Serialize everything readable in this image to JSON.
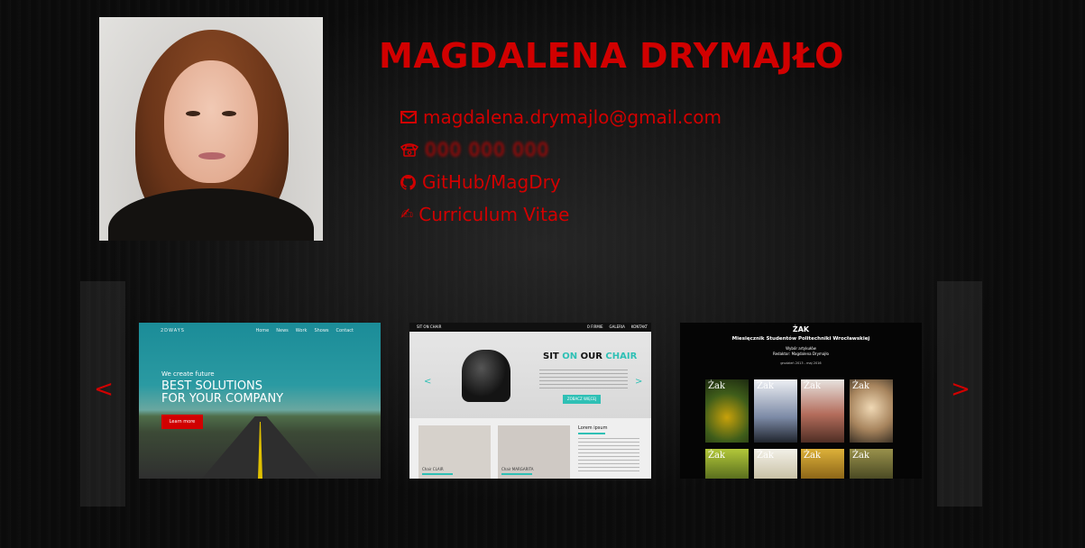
{
  "profile": {
    "name": "MAGDALENA DRYMAJŁO",
    "photo_icon": "profile-photo"
  },
  "contacts": {
    "email": {
      "icon": "envelope-icon",
      "text": "magdalena.drymajlo@gmail.com"
    },
    "phone": {
      "icon": "telephone-icon",
      "text": "000 000 000"
    },
    "github": {
      "icon": "github-icon",
      "text": "GitHub/MagDry"
    },
    "cv": {
      "icon": "writing-hand-icon",
      "text": "Curriculum Vitae"
    }
  },
  "carousel": {
    "prev_label": "<",
    "next_label": ">",
    "slides": [
      {
        "brand": "2DWAYS",
        "nav_links": [
          "Home",
          "News",
          "Work",
          "Shows",
          "Contact"
        ],
        "tagline": "We create future",
        "headline": "BEST SOLUTIONS\nFOR YOUR COMPANY",
        "cta": "Learn more"
      },
      {
        "brand": "SIT ON CHAIR",
        "nav_links": [
          "O FIRMIE",
          "GALERIA",
          "KONTAKT"
        ],
        "title_part1": "SIT ",
        "title_hl": "ON",
        "title_part2": " OUR ",
        "title_hl2": "CHAIR",
        "button": "ZOBACZ WIĘCEJ",
        "card1_caption": "Chair CLAIR",
        "card2_caption": "Chair MARGARITA",
        "side_heading": "Lorem ipsum"
      },
      {
        "title": "ŻAK",
        "subtitle": "Miesięcznik Studentów Politechniki Wrocławskiej",
        "credits": "Wybór artykułów\nRedaktor: Magdalena Drymajło",
        "dates": "grudzień 2013 - maj 2016",
        "cover_label": "Żak"
      }
    ]
  },
  "colors": {
    "accent": "#d10000",
    "background": "#0b0b0b",
    "teal": "#2fc0b5"
  }
}
